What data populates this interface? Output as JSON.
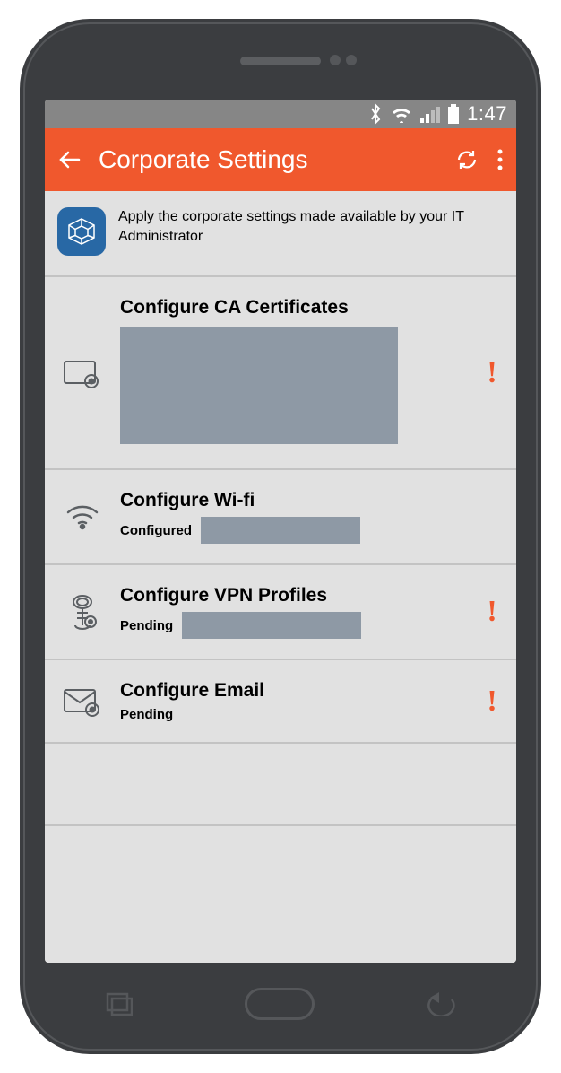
{
  "status": {
    "time": "1:47"
  },
  "appbar": {
    "title": "Corporate Settings"
  },
  "intro": {
    "text": "Apply the corporate settings made available by your IT Administrator"
  },
  "items": [
    {
      "title": "Configure CA Certificates",
      "status": "",
      "alert": true,
      "redact": "big"
    },
    {
      "title": "Configure Wi-fi",
      "status": "Configured",
      "alert": false,
      "redact": "med"
    },
    {
      "title": "Configure VPN Profiles",
      "status": "Pending",
      "alert": true,
      "redact": "med2"
    },
    {
      "title": "Configure Email",
      "status": "Pending",
      "alert": true,
      "redact": ""
    }
  ]
}
